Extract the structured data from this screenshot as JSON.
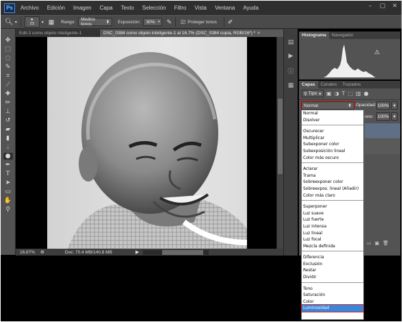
{
  "app": {
    "logo": "Ps"
  },
  "menu": [
    "Archivo",
    "Edición",
    "Imagen",
    "Capa",
    "Texto",
    "Selección",
    "Filtro",
    "Vista",
    "Ventana",
    "Ayuda"
  ],
  "window_controls": [
    "–",
    "▢",
    "✕"
  ],
  "options": {
    "brush_size": "23",
    "range_label": "Rango:",
    "range_value": "Medios tonos",
    "exposure_label": "Exposición:",
    "exposure_value": "30%",
    "protect_label": "Proteger tonos"
  },
  "tabs": [
    {
      "label": "Edit-3 como objeto inteligente-1",
      "active": false
    },
    {
      "label": "DSC_0384 como objeto inteligente-1 al 16.7% (DSC_0384 copia, RGB/16*) *",
      "active": true
    }
  ],
  "tab_close": "×",
  "status": {
    "zoom": "16.67%",
    "doc": "Doc: 70.4 MB/140.8 MB"
  },
  "histogram": {
    "tabs": [
      "Histograma",
      "Navegador"
    ],
    "warning": "⚠"
  },
  "layers": {
    "tabs": [
      "Capas",
      "Canales",
      "Trazados"
    ],
    "filter": "Tipo",
    "blend_mode": "Normal",
    "opacity_label": "Opacidad:",
    "opacity": "100%",
    "fill_partial": "ono:",
    "fill": "100%"
  },
  "blend_groups": [
    [
      "Normal",
      "Disolver"
    ],
    [
      "Oscurecer",
      "Multiplicar",
      "Subexponer color",
      "Subexposición lineal",
      "Color más oscuro"
    ],
    [
      "Aclarar",
      "Trama",
      "Sobreexponer color",
      "Sobreexpos. lineal (Añadir)",
      "Color más claro"
    ],
    [
      "Superponer",
      "Luz suave",
      "Luz fuerte",
      "Luz intensa",
      "Luz lineal",
      "Luz focal",
      "Mezcla definida"
    ],
    [
      "Diferencia",
      "Exclusión",
      "Restar",
      "Dividir"
    ],
    [
      "Tono",
      "Saturación",
      "Color",
      "Luminosidad"
    ]
  ],
  "selected_blend": "Luminosidad",
  "colors": {
    "highlight": "#3a86d8",
    "outline": "#e02020"
  }
}
